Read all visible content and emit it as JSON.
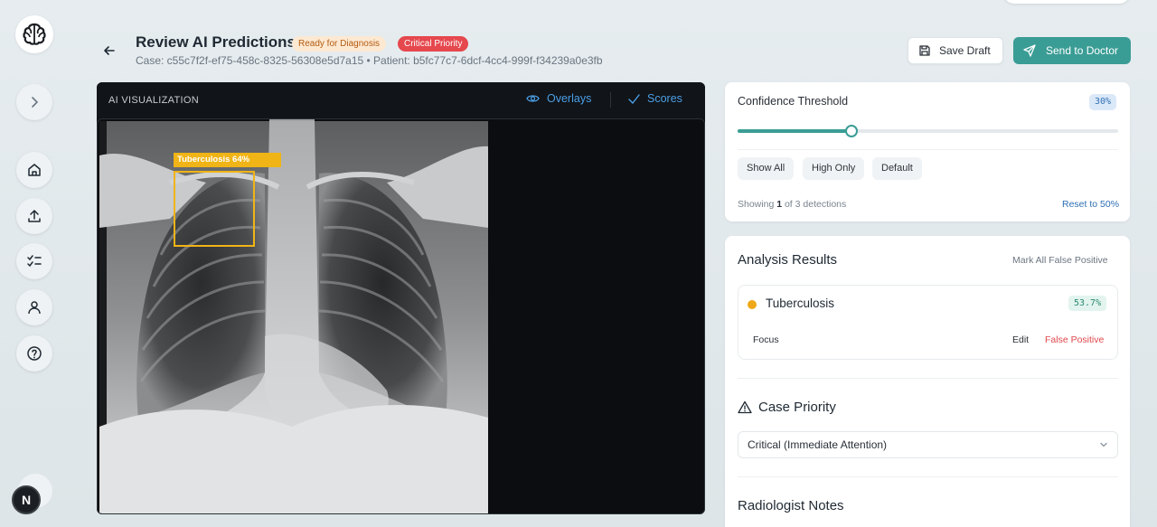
{
  "header": {
    "title": "Review AI Predictions",
    "badge_ready": "Ready for Diagnosis",
    "badge_critical": "Critical Priority",
    "subtitle": "Case: c55c7f2f-ef75-458c-8325-56308e5d7a15 • Patient: b5fc77c7-6dcf-4cc4-999f-f34239a0e3fb",
    "save_draft_label": "Save Draft",
    "send_label": "Send to Doctor"
  },
  "sidebar": {
    "avatar_initial": "N",
    "items": [
      "home-icon",
      "upload-icon",
      "checklist-icon",
      "user-icon",
      "help-icon"
    ]
  },
  "viewer": {
    "label": "AI VISUALIZATION",
    "tab_overlays": "Overlays",
    "tab_scores": "Scores",
    "detection_label": "Tuberculosis 64%"
  },
  "threshold": {
    "title": "Confidence Threshold",
    "value_label": "30%",
    "value": 0.3,
    "chips": [
      "Show All",
      "High Only",
      "Default"
    ],
    "showing_prefix": "Showing",
    "showing_count": "1",
    "showing_suffix": "of 3 detections",
    "reset_label": "Reset to 50%"
  },
  "results": {
    "title": "Analysis Results",
    "mark_all_label": "Mark All False Positive",
    "finding": {
      "name": "Tuberculosis",
      "score": "53.7%",
      "focus_label": "Focus",
      "edit_label": "Edit",
      "false_positive_label": "False Positive"
    },
    "priority_title": "Case Priority",
    "priority_value": "Critical (Immediate Attention)",
    "notes_title": "Radiologist Notes"
  },
  "colors": {
    "accent": "#3a9d95",
    "link": "#4b9fe6",
    "critical": "#e5484d",
    "detection": "#f0b416"
  }
}
